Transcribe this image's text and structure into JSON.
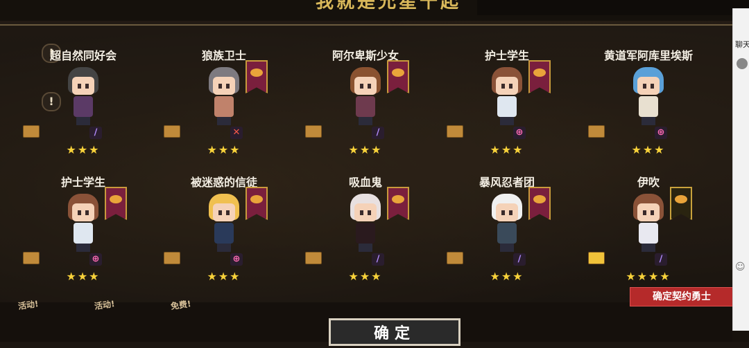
{
  "header": {
    "title": "我就是允星千起"
  },
  "characters": [
    {
      "name": "超自然同好会",
      "stars": "★★★",
      "role_icon": "staff-icon",
      "role_glyph": "∕",
      "role_color": "#b38cff",
      "hair": "#444444",
      "outfit": "#5b3a66",
      "banner": false
    },
    {
      "name": "狼族卫士",
      "stars": "★★★",
      "role_icon": "sword-icon",
      "role_glyph": "✕",
      "role_color": "#ff5a4a",
      "hair": "#7d7a80",
      "outfit": "#c0826b",
      "banner": true
    },
    {
      "name": "阿尔卑斯少女",
      "stars": "★★★",
      "role_icon": "staff-icon",
      "role_glyph": "∕",
      "role_color": "#b38cff",
      "hair": "#8a5230",
      "outfit": "#6e3a4e",
      "banner": true
    },
    {
      "name": "护士学生",
      "stars": "★★★",
      "role_icon": "cross-icon",
      "role_glyph": "⊕",
      "role_color": "#ff6ab4",
      "hair": "#8a5238",
      "outfit": "#dfe7f0",
      "banner": true
    },
    {
      "name": "黄道军阿库里埃斯",
      "stars": "★★★",
      "role_icon": "cross-icon",
      "role_glyph": "⊕",
      "role_color": "#ff6ab4",
      "hair": "#5aa0d8",
      "outfit": "#e8e0d0",
      "banner": false
    },
    {
      "name": "护士学生",
      "stars": "★★★",
      "role_icon": "cross-icon",
      "role_glyph": "⊕",
      "role_color": "#ff6ab4",
      "hair": "#8a5238",
      "outfit": "#dfe7f0",
      "banner": true
    },
    {
      "name": "被迷惑的信徒",
      "stars": "★★★",
      "role_icon": "cross-icon",
      "role_glyph": "⊕",
      "role_color": "#ff6ab4",
      "hair": "#f0c050",
      "outfit": "#2a3a5a",
      "banner": true
    },
    {
      "name": "吸血鬼",
      "stars": "★★★",
      "role_icon": "staff-icon",
      "role_glyph": "∕",
      "role_color": "#b38cff",
      "hair": "#e8e0e0",
      "outfit": "#2a1a1e",
      "banner": true
    },
    {
      "name": "暴风忍者团",
      "stars": "★★★",
      "role_icon": "staff-icon",
      "role_glyph": "∕",
      "role_color": "#b38cff",
      "hair": "#f0f0f0",
      "outfit": "#3a4a5a",
      "banner": true
    },
    {
      "name": "伊吹",
      "stars": "★★★★",
      "role_icon": "staff-icon",
      "role_glyph": "∕",
      "role_color": "#b38cff",
      "hair": "#8a5238",
      "outfit": "#e8e8f0",
      "banner": true,
      "banner_dark": true,
      "gold_scroll": true
    }
  ],
  "buttons": {
    "confirm_tag": "确定契约勇士",
    "confirm": "确定"
  },
  "events": [
    "活动!",
    "活动!",
    "免费!"
  ],
  "chat": {
    "title": "聊天"
  }
}
